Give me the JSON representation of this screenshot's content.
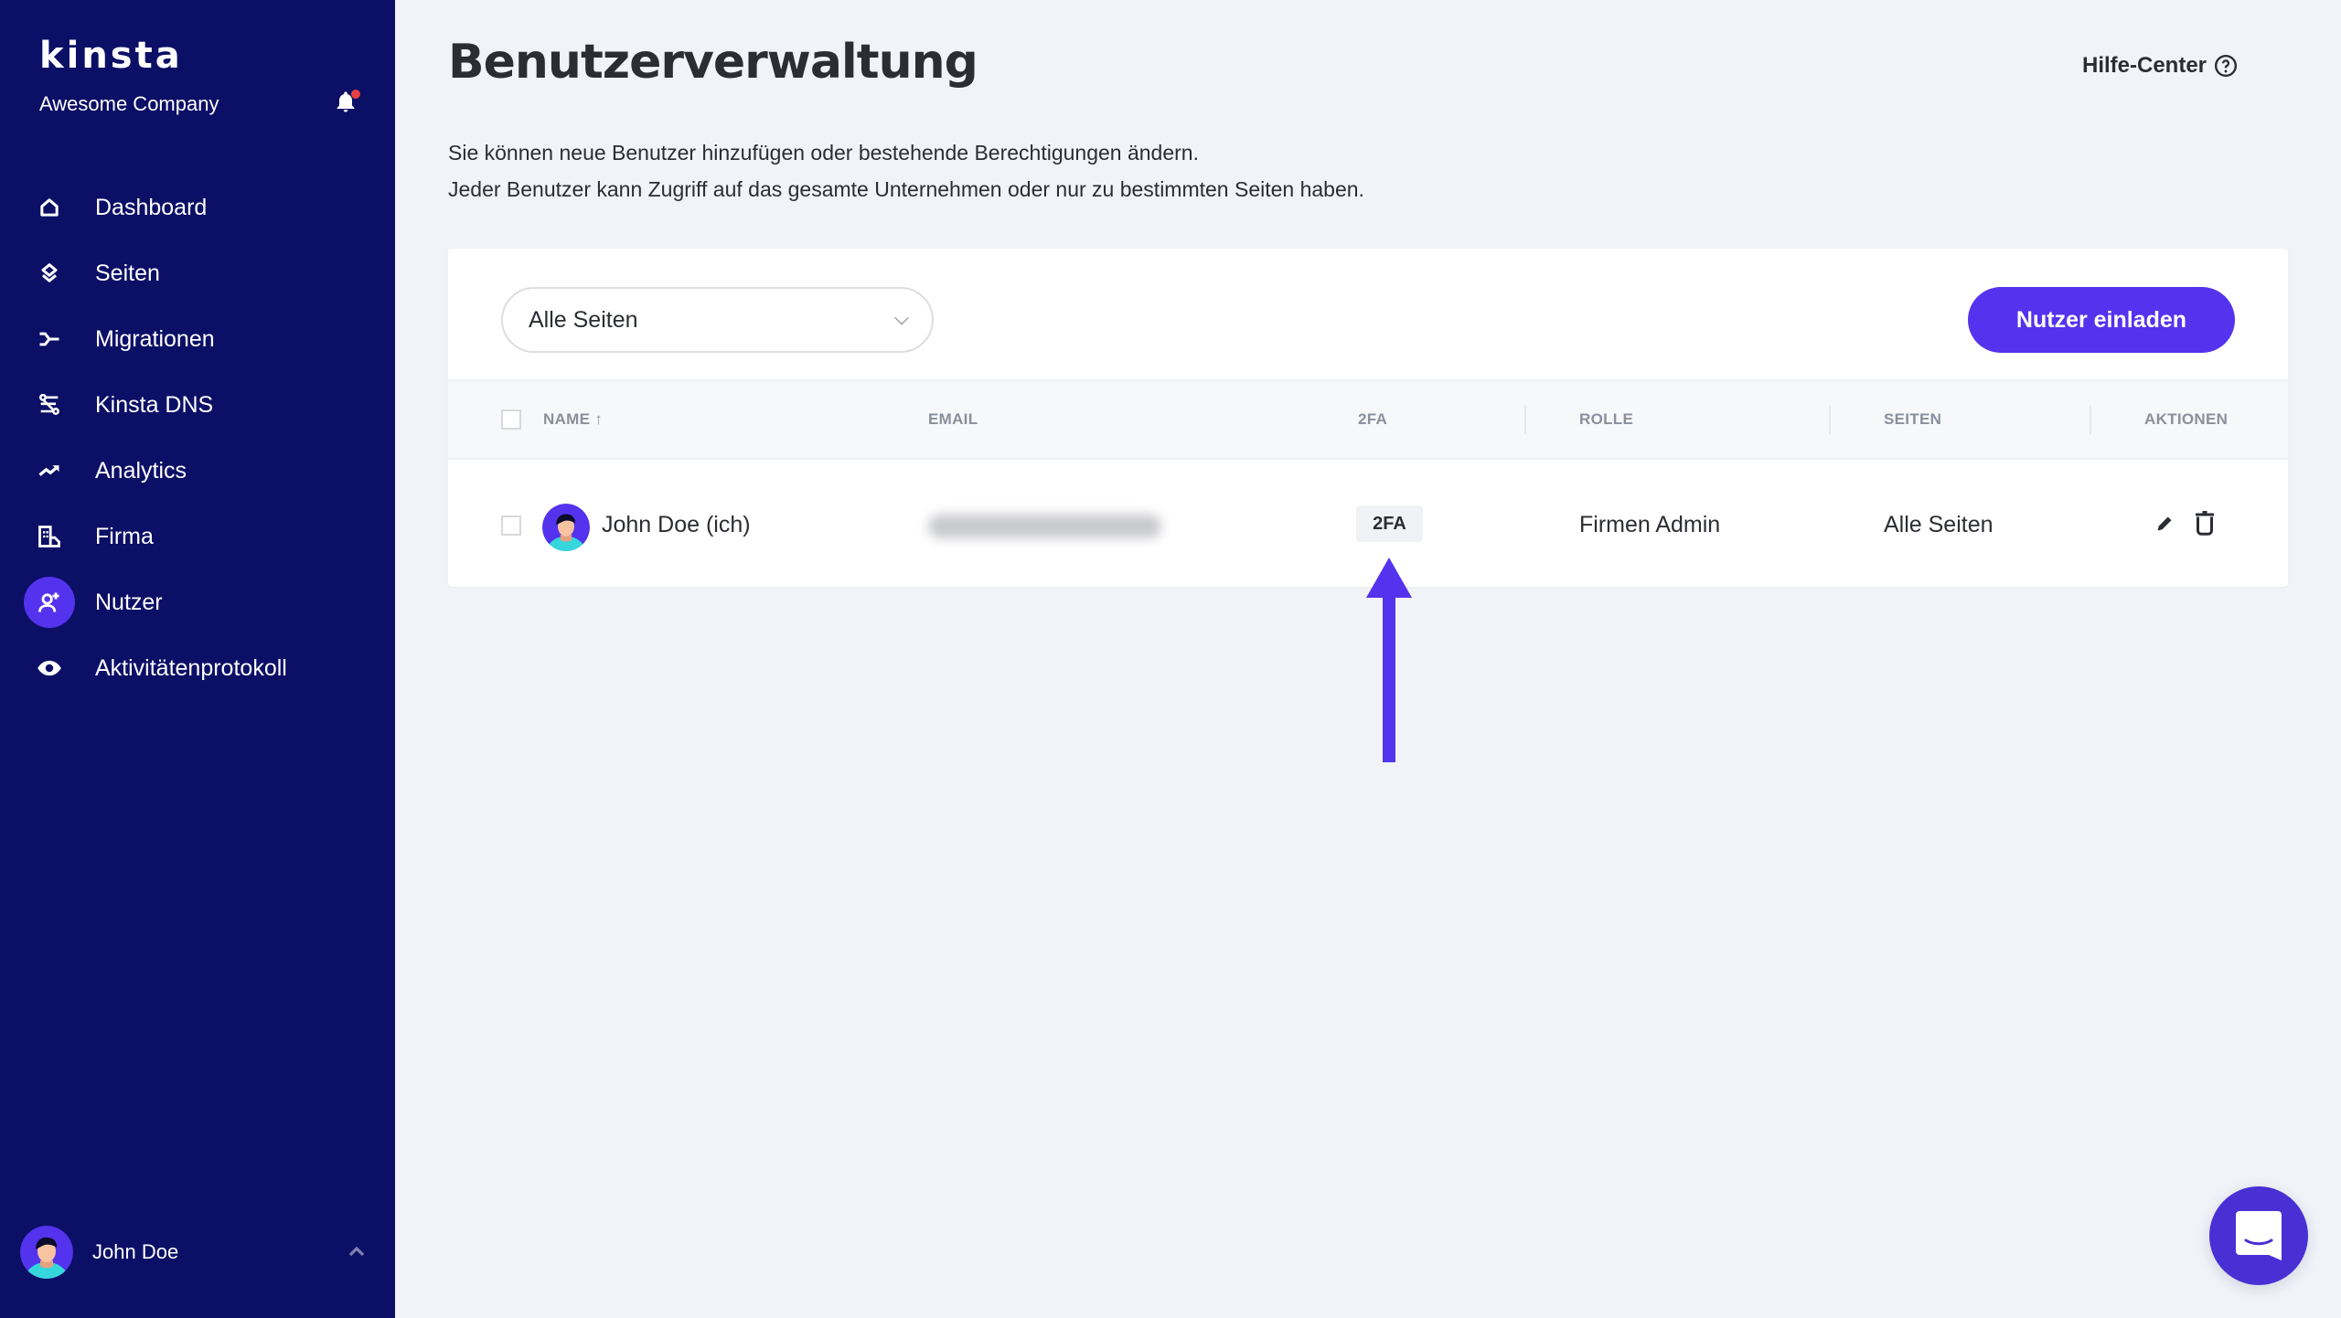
{
  "sidebar": {
    "logo": "kinsta",
    "company": "Awesome Company",
    "notification_icon": "bell-icon",
    "items": [
      {
        "label": "Dashboard",
        "icon": "home-icon",
        "active": false
      },
      {
        "label": "Seiten",
        "icon": "layers-icon",
        "active": false
      },
      {
        "label": "Migrationen",
        "icon": "migration-icon",
        "active": false
      },
      {
        "label": "Kinsta DNS",
        "icon": "dns-icon",
        "active": false
      },
      {
        "label": "Analytics",
        "icon": "trend-up-icon",
        "active": false
      },
      {
        "label": "Firma",
        "icon": "building-icon",
        "active": false
      },
      {
        "label": "Nutzer",
        "icon": "user-plus-icon",
        "active": true
      },
      {
        "label": "Aktivitätenprotokoll",
        "icon": "eye-icon",
        "active": false
      }
    ],
    "user": {
      "name": "John Doe",
      "expand_icon": "chevron-up-icon"
    }
  },
  "header": {
    "title": "Benutzerverwaltung",
    "help_label": "Hilfe-Center",
    "description": [
      "Sie können neue Benutzer hinzufügen oder bestehende Berechtigungen ändern.",
      "Jeder Benutzer kann Zugriff auf das gesamte Unternehmen oder nur zu bestimmten Seiten haben."
    ]
  },
  "toolbar": {
    "filter_selected": "Alle Seiten",
    "invite_label": "Nutzer einladen"
  },
  "table": {
    "columns": {
      "name": "NAME",
      "name_sort": "↑",
      "email": "EMAIL",
      "twofa": "2FA",
      "role": "ROLLE",
      "sites": "SEITEN",
      "actions": "AKTIONEN"
    },
    "rows": [
      {
        "name": "John Doe (ich)",
        "email": "(blurred)",
        "twofa": "2FA",
        "role": "Firmen Admin",
        "sites": "Alle Seiten",
        "actions": [
          "edit-icon",
          "trash-icon"
        ]
      }
    ]
  },
  "annotation": {
    "type": "arrow-up",
    "points_to": "2FA badge",
    "color": "#5333ed"
  },
  "colors": {
    "sidebar_bg": "#0c0f66",
    "accent": "#5333ed",
    "page_bg": "#f2f3f8",
    "notification_dot": "#e74040"
  },
  "chat_widget": {
    "icon": "chat-icon"
  }
}
